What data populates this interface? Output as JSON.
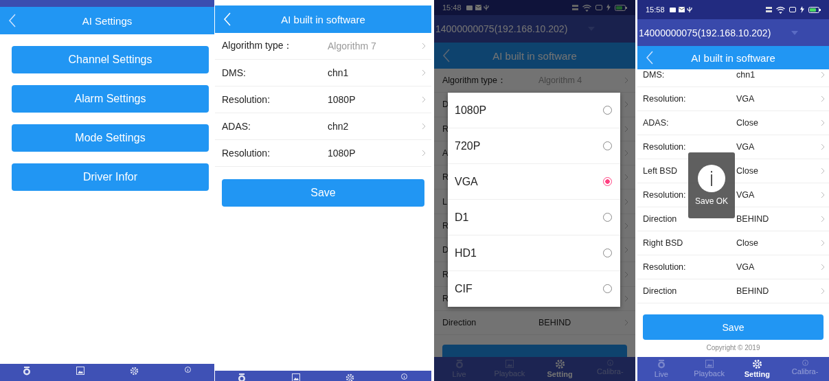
{
  "screens": [
    {
      "kind": "menu",
      "title": "AI Settings",
      "buttons": [
        "Channel Settings",
        "Alarm Settings",
        "Mode Settings",
        "Driver Infor"
      ]
    },
    {
      "kind": "form",
      "title": "AI built in software",
      "rows": [
        {
          "label": "Algorithm type：",
          "placeholder": "Algorithm 7"
        },
        {
          "label": "DMS:",
          "value": "chn1"
        },
        {
          "label": "Resolution:",
          "value": "1080P"
        },
        {
          "label": "ADAS:",
          "value": "chn2"
        },
        {
          "label": "Resolution:",
          "value": "1080P"
        }
      ],
      "save": "Save"
    },
    {
      "kind": "form",
      "time": "15:48",
      "device": "14000000075(192.168.10.202)",
      "title": "AI built in software",
      "rows": [
        {
          "label": "Algorithm type：",
          "placeholder": "Algorithm 4"
        },
        {
          "label": "D"
        },
        {
          "label": "R"
        },
        {
          "label": "A"
        },
        {
          "label": "R"
        },
        {
          "label": "L"
        },
        {
          "label": "R"
        },
        {
          "label": "D"
        },
        {
          "label": "R"
        },
        {
          "label": "R"
        },
        {
          "label": "Direction",
          "value": "BEHIND"
        }
      ],
      "dialog": [
        {
          "label": "1080P",
          "selected": false
        },
        {
          "label": "720P",
          "selected": false
        },
        {
          "label": "VGA",
          "selected": true
        },
        {
          "label": "D1",
          "selected": false
        },
        {
          "label": "HD1",
          "selected": false
        },
        {
          "label": "CIF",
          "selected": false
        }
      ],
      "nav": [
        {
          "label": "Live",
          "selected": false
        },
        {
          "label": "Playback",
          "selected": false
        },
        {
          "label": "Setting",
          "selected": true
        },
        {
          "label": "Calibra-",
          "selected": false
        }
      ]
    },
    {
      "kind": "form",
      "time": "15:58",
      "device": "14000000075(192.168.10.202)",
      "title": "AI built in software",
      "rows": [
        {
          "label": "DMS:",
          "value": "chn1"
        },
        {
          "label": "Resolution:",
          "value": "VGA"
        },
        {
          "label": "ADAS:",
          "value": "Close"
        },
        {
          "label": "Resolution:",
          "value": "VGA"
        },
        {
          "label": "Left BSD",
          "value": "Close"
        },
        {
          "label": "Resolution:",
          "value": "VGA"
        },
        {
          "label": "Direction",
          "value": "BEHIND"
        },
        {
          "label": "Right BSD",
          "value": "Close"
        },
        {
          "label": "Resolution:",
          "value": "VGA"
        },
        {
          "label": "Direction",
          "value": "BEHIND"
        }
      ],
      "save": "Save",
      "copyright": "Copyright © 2019",
      "toast": "Save OK",
      "nav": [
        {
          "label": "Live",
          "selected": false
        },
        {
          "label": "Playback",
          "selected": false
        },
        {
          "label": "Setting",
          "selected": true
        },
        {
          "label": "Calibra-",
          "selected": false
        }
      ]
    }
  ]
}
